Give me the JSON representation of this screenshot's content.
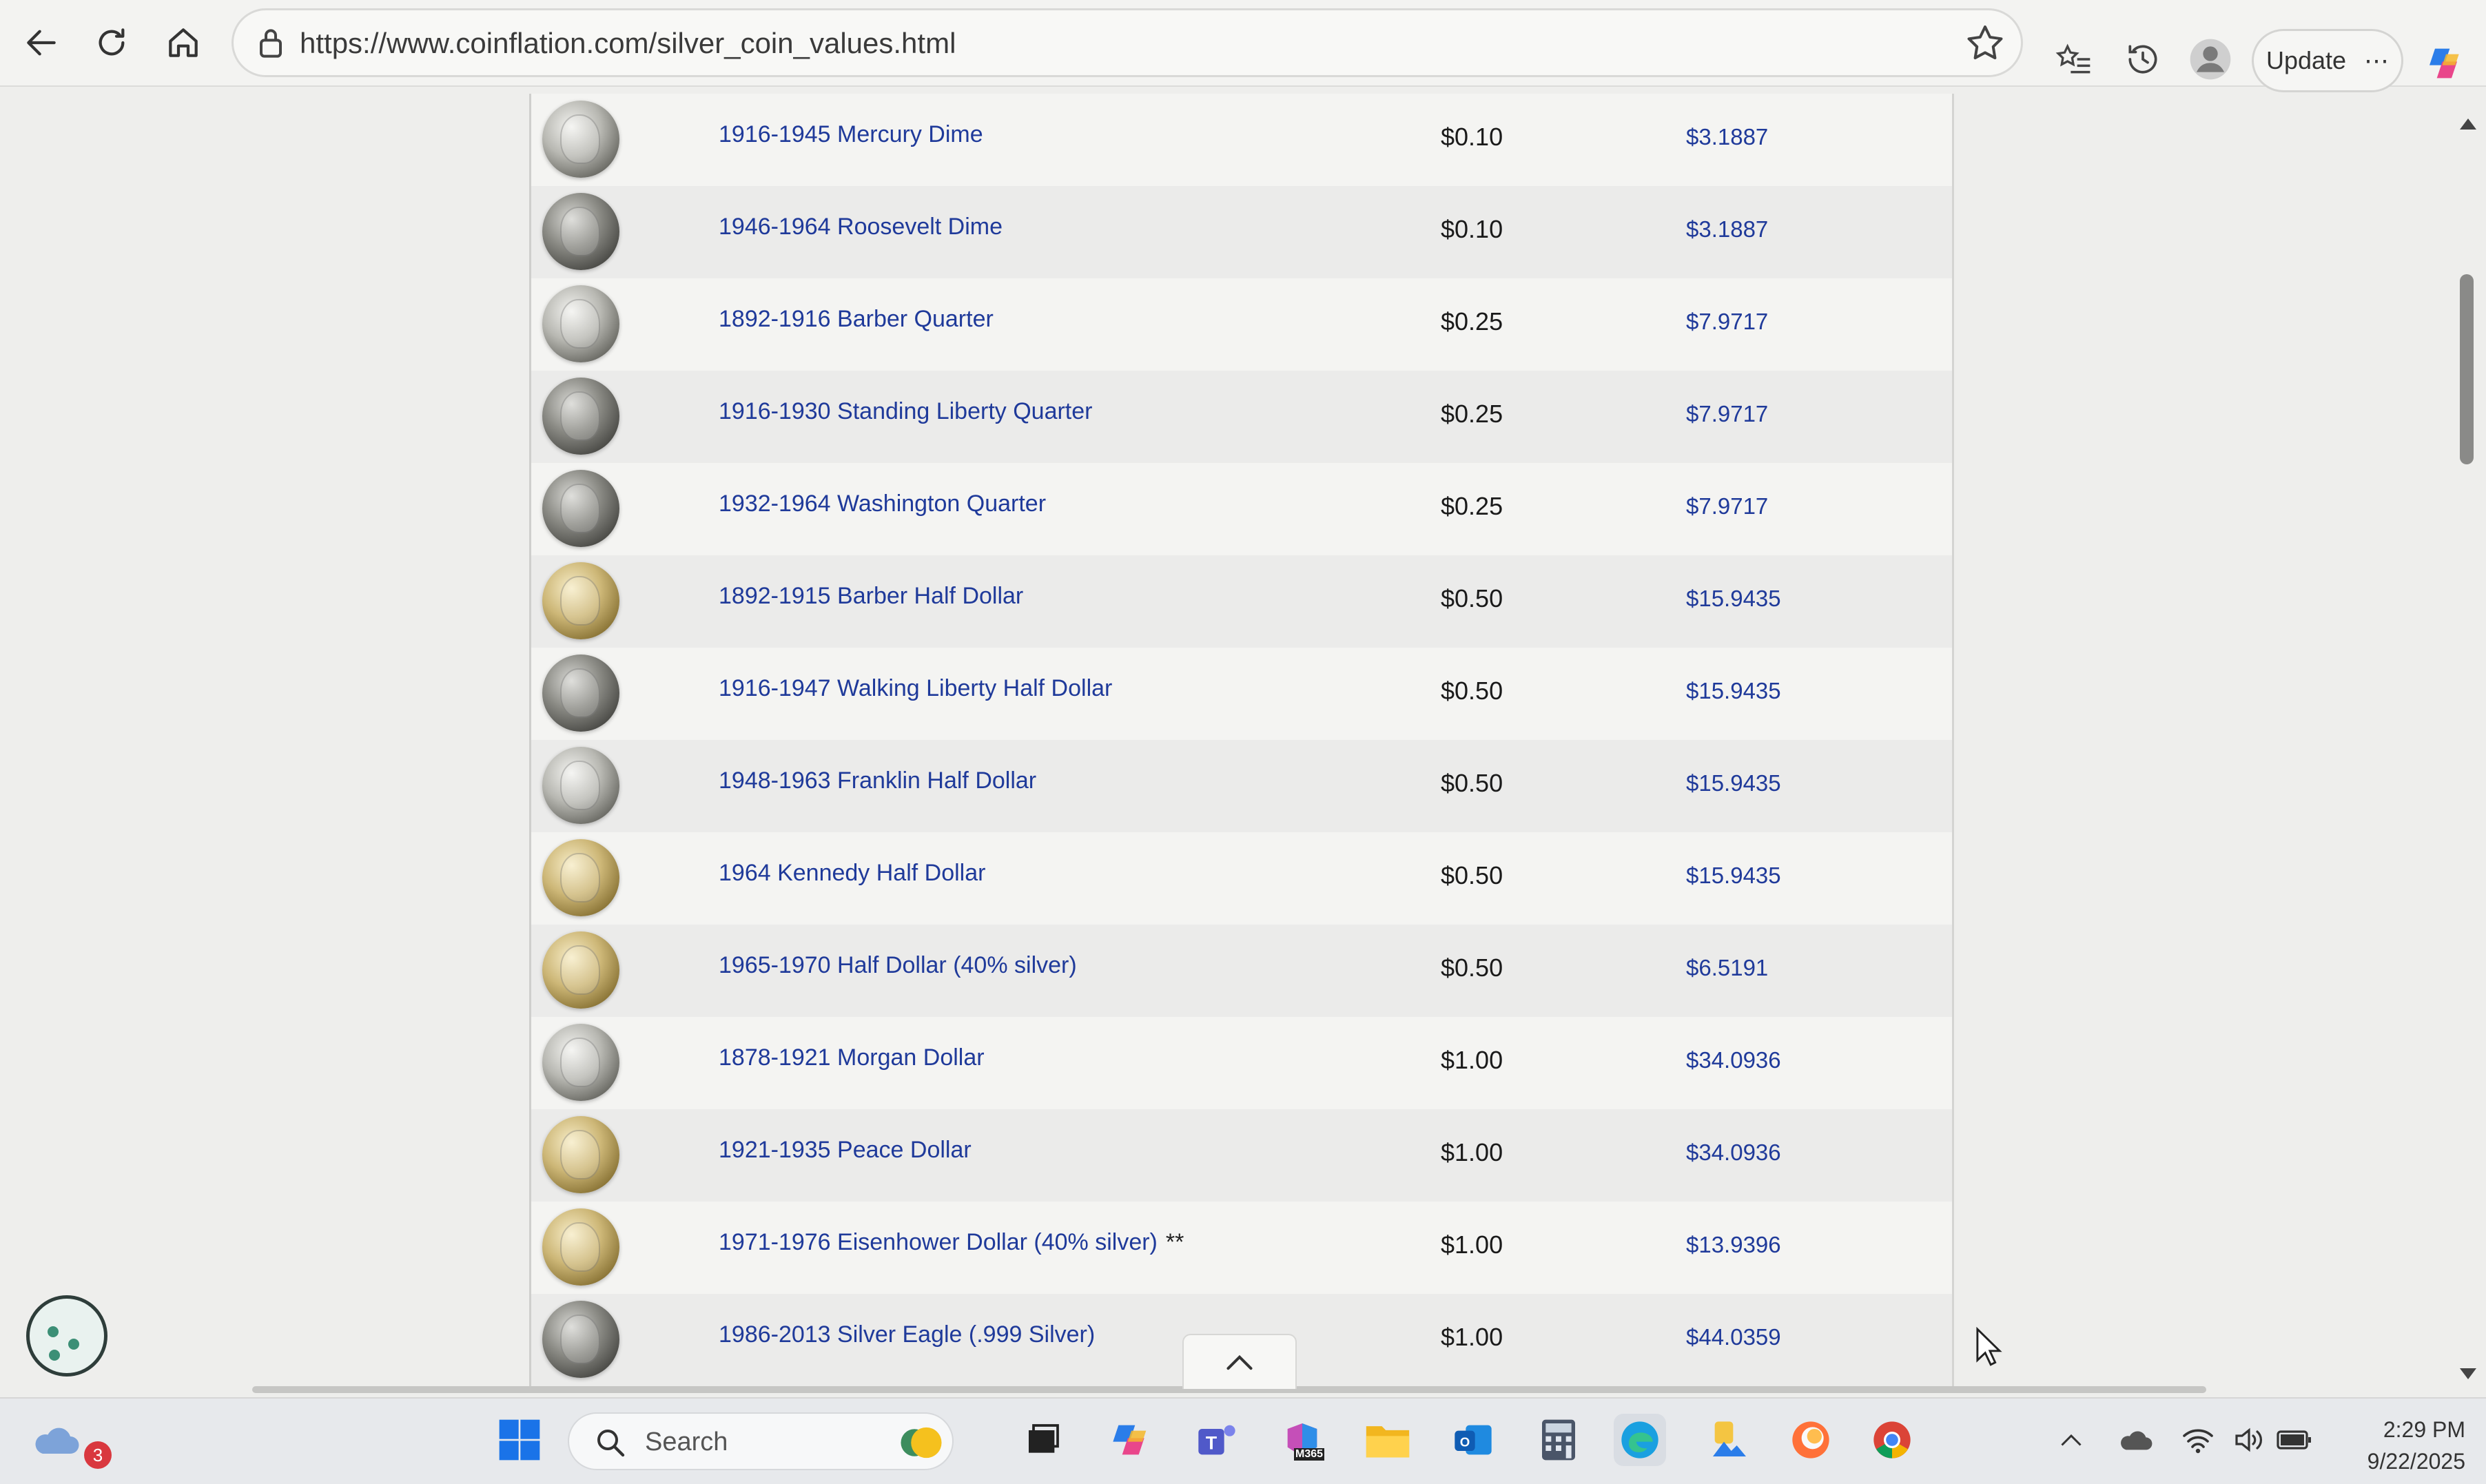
{
  "browser": {
    "url": "https://www.coinflation.com/silver_coin_values.html",
    "update_label": "Update",
    "more_label": "⋯"
  },
  "coins": [
    {
      "name": "1916-1945 Mercury Dime",
      "face": "$0.10",
      "melt": "$3.1887",
      "tone": "silver"
    },
    {
      "name": "1946-1964 Roosevelt Dime",
      "face": "$0.10",
      "melt": "$3.1887",
      "tone": "dark"
    },
    {
      "name": "1892-1916 Barber Quarter",
      "face": "$0.25",
      "melt": "$7.9717",
      "tone": "silver"
    },
    {
      "name": "1916-1930 Standing Liberty Quarter",
      "face": "$0.25",
      "melt": "$7.9717",
      "tone": "dark"
    },
    {
      "name": "1932-1964 Washington Quarter",
      "face": "$0.25",
      "melt": "$7.9717",
      "tone": "dark"
    },
    {
      "name": "1892-1915 Barber Half Dollar",
      "face": "$0.50",
      "melt": "$15.9435",
      "tone": "gold"
    },
    {
      "name": "1916-1947 Walking Liberty Half Dollar",
      "face": "$0.50",
      "melt": "$15.9435",
      "tone": "dark"
    },
    {
      "name": "1948-1963 Franklin Half Dollar",
      "face": "$0.50",
      "melt": "$15.9435",
      "tone": "silver"
    },
    {
      "name": "1964 Kennedy Half Dollar",
      "face": "$0.50",
      "melt": "$15.9435",
      "tone": "gold"
    },
    {
      "name": "1965-1970 Half Dollar (40% silver)",
      "face": "$0.50",
      "melt": "$6.5191",
      "tone": "gold"
    },
    {
      "name": "1878-1921 Morgan Dollar",
      "face": "$1.00",
      "melt": "$34.0936",
      "tone": "silver"
    },
    {
      "name": "1921-1935 Peace Dollar",
      "face": "$1.00",
      "melt": "$34.0936",
      "tone": "gold"
    },
    {
      "name": "1971-1976 Eisenhower Dollar (40% silver)",
      "note": "**",
      "face": "$1.00",
      "melt": "$13.9396",
      "tone": "gold"
    },
    {
      "name": "1986-2013 Silver Eagle (.999 Silver)",
      "face": "$1.00",
      "melt": "$44.0359",
      "tone": "dark"
    }
  ],
  "taskbar": {
    "search_label": "Search",
    "notification_count": "3",
    "time": "2:29 PM",
    "date": "9/22/2025",
    "m365_label": "M365"
  },
  "colors": {
    "link": "#1f3a9a",
    "row_alt": "#ebebea",
    "page_bg": "#eeeeec"
  }
}
